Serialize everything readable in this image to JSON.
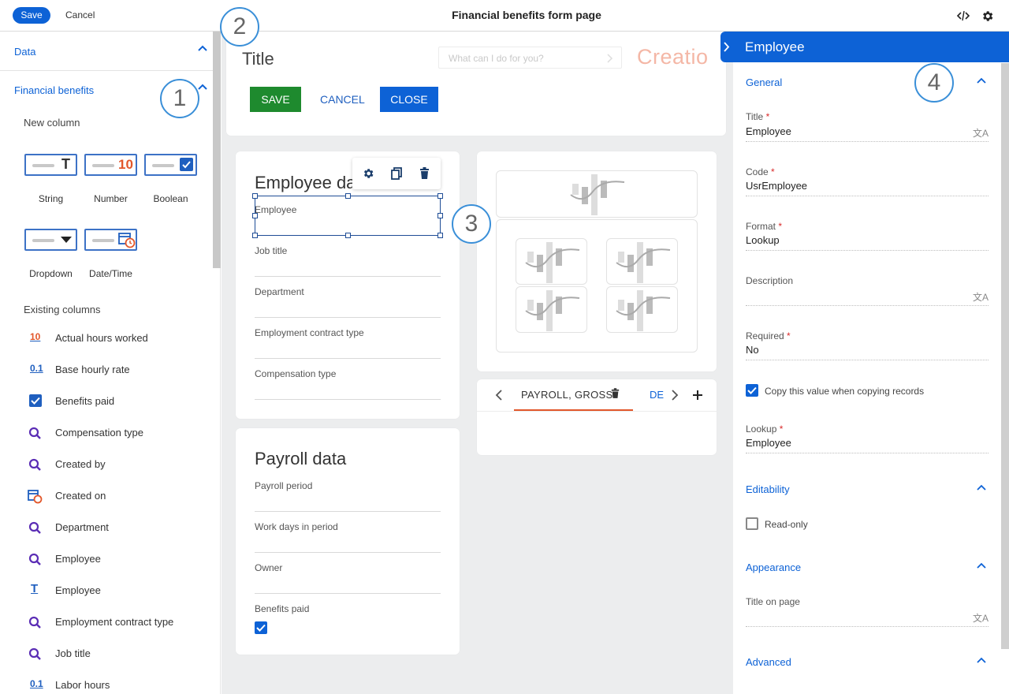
{
  "topbar": {
    "save_label": "Save",
    "cancel_label": "Cancel",
    "title": "Financial benefits form page"
  },
  "left_panel": {
    "data_section": "Data",
    "fin_section": "Financial benefits",
    "new_column_label": "New column",
    "tiles": {
      "string": "String",
      "number": "Number",
      "number_glyph": "10",
      "boolean": "Boolean",
      "dropdown": "Dropdown",
      "datetime": "Date/Time"
    },
    "existing_label": "Existing columns",
    "existing": [
      {
        "icon": "number-icon",
        "glyph": "10",
        "label": "Actual hours worked"
      },
      {
        "icon": "decimal-icon",
        "glyph": "0.1",
        "label": "Base hourly rate"
      },
      {
        "icon": "checkbox-icon",
        "glyph": "",
        "label": "Benefits paid"
      },
      {
        "icon": "lookup-icon",
        "glyph": "",
        "label": "Compensation type"
      },
      {
        "icon": "lookup-icon",
        "glyph": "",
        "label": "Created by"
      },
      {
        "icon": "datetime-icon",
        "glyph": "",
        "label": "Created on"
      },
      {
        "icon": "lookup-icon",
        "glyph": "",
        "label": "Department"
      },
      {
        "icon": "lookup-icon",
        "glyph": "",
        "label": "Employee"
      },
      {
        "icon": "string-icon",
        "glyph": "T",
        "label": "Employee"
      },
      {
        "icon": "lookup-icon",
        "glyph": "",
        "label": "Employment contract type"
      },
      {
        "icon": "lookup-icon",
        "glyph": "",
        "label": "Job title"
      },
      {
        "icon": "decimal-icon",
        "glyph": "0.1",
        "label": "Labor hours"
      }
    ]
  },
  "canvas": {
    "header_title": "Title",
    "search_placeholder": "What can I do for you?",
    "logo": "Creatio",
    "save_btn": "SAVE",
    "cancel_btn": "CANCEL",
    "close_btn": "CLOSE",
    "employee_card": {
      "title": "Employee data",
      "fields": [
        "Employee",
        "Job title",
        "Department",
        "Employment contract type",
        "Compensation type"
      ]
    },
    "payroll_card": {
      "title": "Payroll data",
      "fields": [
        "Payroll period",
        "Work days in period",
        "Owner"
      ],
      "checkbox_field": "Benefits paid"
    },
    "tabs": {
      "active": "PAYROLL, GROSS",
      "next": "DE"
    },
    "callouts": [
      "1",
      "2",
      "3",
      "4"
    ]
  },
  "right_panel": {
    "header": "Employee",
    "general": "General",
    "title_label": "Title",
    "title_value": "Employee",
    "code_label": "Code",
    "code_value": "UsrEmployee",
    "format_label": "Format",
    "format_value": "Lookup",
    "description_label": "Description",
    "required_label": "Required",
    "required_value": "No",
    "copy_label": "Copy this value when copying records",
    "lookup_label": "Lookup",
    "lookup_value": "Employee",
    "editability": "Editability",
    "readonly_label": "Read-only",
    "appearance": "Appearance",
    "title_on_page_label": "Title on page",
    "advanced": "Advanced",
    "required_mark": "*"
  },
  "colors": {
    "accent": "#0d62d6",
    "save_green": "#1e8a2e",
    "canvas_bg": "#ecedee",
    "callout": "#3a8fd8"
  }
}
